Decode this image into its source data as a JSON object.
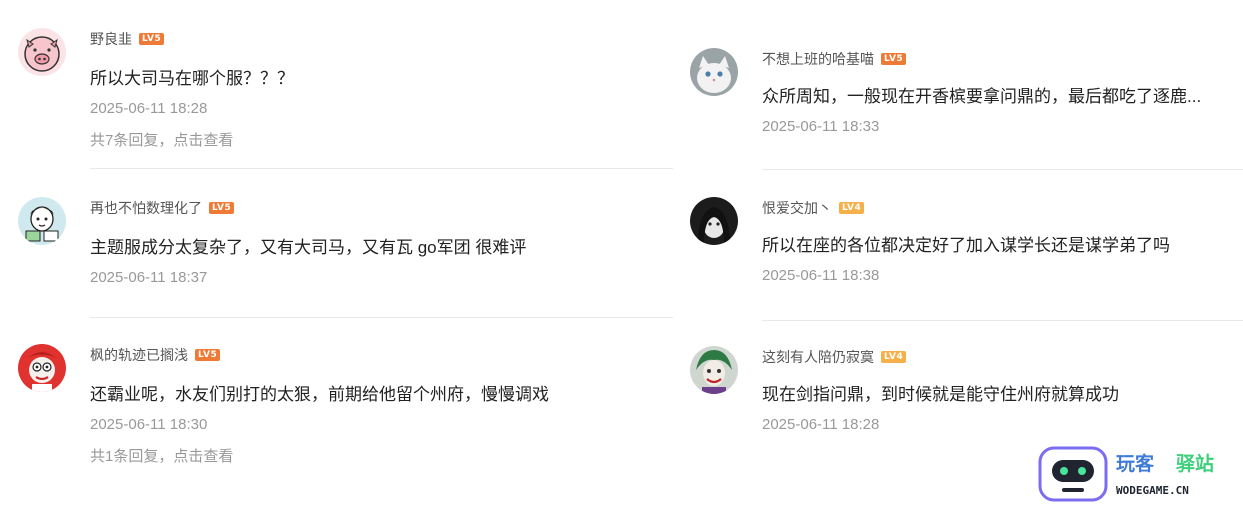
{
  "level_badge_colors": {
    "lv5": "#ef7a36",
    "lv4": "#f5b04a"
  },
  "left_comments": [
    {
      "user": "野良韭",
      "level": "LV5",
      "text": "所以大司马在哪个服？？？",
      "time": "2025-06-11 18:28",
      "replies": "共7条回复，点击查看"
    },
    {
      "user": "再也不怕数理化了",
      "level": "LV5",
      "text": "主题服成分太复杂了，又有大司马，又有瓦 go军团 很难评",
      "time": "2025-06-11 18:37"
    },
    {
      "user": "枫的轨迹已搁浅",
      "level": "LV5",
      "text": "还霸业呢，水友们别打的太狠，前期给他留个州府，慢慢调戏",
      "time": "2025-06-11 18:30",
      "replies": "共1条回复，点击查看"
    }
  ],
  "right_comments": [
    {
      "user": "不想上班的哈基喵",
      "level": "LV5",
      "text": "众所周知，一般现在开香槟要拿问鼎的，最后都吃了逐鹿...",
      "time": "2025-06-11 18:33"
    },
    {
      "user": "恨爱交加丶",
      "level": "LV4",
      "text": "所以在座的各位都决定好了加入谋学长还是谋学弟了吗",
      "time": "2025-06-11 18:38"
    },
    {
      "user": "这刻有人陪仍寂寞",
      "level": "LV4",
      "text": "现在剑指问鼎，到时候就是能守住州府就算成功",
      "time": "2025-06-11 18:28"
    }
  ],
  "watermark": {
    "title_a": "玩客",
    "title_b": "驿站",
    "domain": "WODEGAME.CN"
  }
}
